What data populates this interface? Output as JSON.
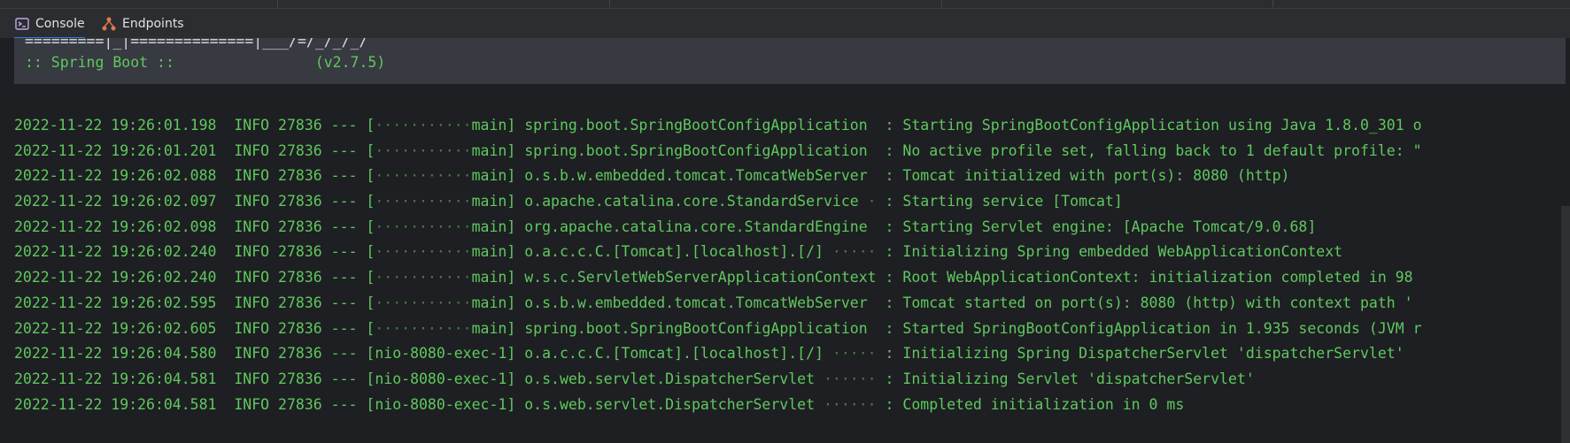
{
  "tabs": [
    {
      "label": "Console",
      "icon": "console-icon",
      "active": true
    },
    {
      "label": "Endpoints",
      "icon": "endpoints-icon",
      "active": false
    }
  ],
  "banner": {
    "line1": "=========|_|==============|___/=/_/_/_/",
    "line2": ":: Spring Boot ::                (v2.7.5)"
  },
  "log": [
    {
      "ts": "2022-11-22 19:26:01.198",
      "level": "INFO",
      "pid": "27836",
      "thread": "main",
      "logger": "spring.boot.SpringBootConfigApplication",
      "message": "Starting SpringBootConfigApplication using Java 1.8.0_301 o"
    },
    {
      "ts": "2022-11-22 19:26:01.201",
      "level": "INFO",
      "pid": "27836",
      "thread": "main",
      "logger": "spring.boot.SpringBootConfigApplication",
      "message": "No active profile set, falling back to 1 default profile: \""
    },
    {
      "ts": "2022-11-22 19:26:02.088",
      "level": "INFO",
      "pid": "27836",
      "thread": "main",
      "logger": "o.s.b.w.embedded.tomcat.TomcatWebServer",
      "message": "Tomcat initialized with port(s): 8080 (http)"
    },
    {
      "ts": "2022-11-22 19:26:02.097",
      "level": "INFO",
      "pid": "27836",
      "thread": "main",
      "logger": "o.apache.catalina.core.StandardService",
      "message": "Starting service [Tomcat]"
    },
    {
      "ts": "2022-11-22 19:26:02.098",
      "level": "INFO",
      "pid": "27836",
      "thread": "main",
      "logger": "org.apache.catalina.core.StandardEngine",
      "message": "Starting Servlet engine: [Apache Tomcat/9.0.68]"
    },
    {
      "ts": "2022-11-22 19:26:02.240",
      "level": "INFO",
      "pid": "27836",
      "thread": "main",
      "logger": "o.a.c.c.C.[Tomcat].[localhost].[/]",
      "message": "Initializing Spring embedded WebApplicationContext"
    },
    {
      "ts": "2022-11-22 19:26:02.240",
      "level": "INFO",
      "pid": "27836",
      "thread": "main",
      "logger": "w.s.c.ServletWebServerApplicationContext",
      "message": "Root WebApplicationContext: initialization completed in 98"
    },
    {
      "ts": "2022-11-22 19:26:02.595",
      "level": "INFO",
      "pid": "27836",
      "thread": "main",
      "logger": "o.s.b.w.embedded.tomcat.TomcatWebServer",
      "message": "Tomcat started on port(s): 8080 (http) with context path '"
    },
    {
      "ts": "2022-11-22 19:26:02.605",
      "level": "INFO",
      "pid": "27836",
      "thread": "main",
      "logger": "spring.boot.SpringBootConfigApplication",
      "message": "Started SpringBootConfigApplication in 1.935 seconds (JVM r"
    },
    {
      "ts": "2022-11-22 19:26:04.580",
      "level": "INFO",
      "pid": "27836",
      "thread": "nio-8080-exec-1",
      "logger": "o.a.c.c.C.[Tomcat].[localhost].[/]",
      "message": "Initializing Spring DispatcherServlet 'dispatcherServlet'"
    },
    {
      "ts": "2022-11-22 19:26:04.581",
      "level": "INFO",
      "pid": "27836",
      "thread": "nio-8080-exec-1",
      "logger": "o.s.web.servlet.DispatcherServlet",
      "message": "Initializing Servlet 'dispatcherServlet'"
    },
    {
      "ts": "2022-11-22 19:26:04.581",
      "level": "INFO",
      "pid": "27836",
      "thread": "nio-8080-exec-1",
      "logger": "o.s.web.servlet.DispatcherServlet",
      "message": "Completed initialization in 0 ms"
    }
  ],
  "colors": {
    "log_green": "#5fc85f",
    "console_bg": "#1e1f22",
    "tab_accent": "#3574f0"
  }
}
